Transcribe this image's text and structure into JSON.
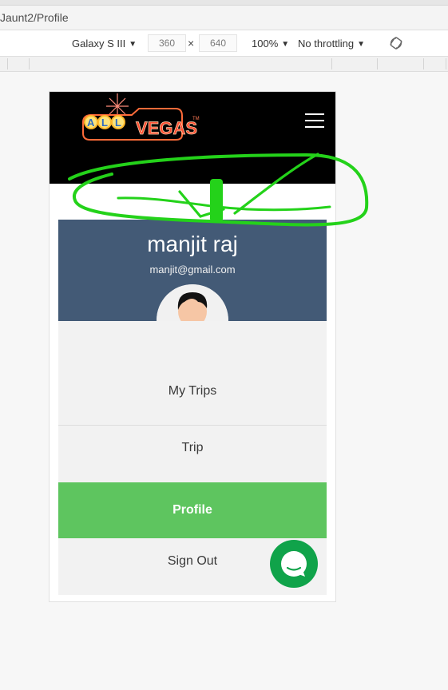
{
  "browser": {
    "address": "Jaunt2/Profile",
    "device": "Galaxy S III",
    "width": "360",
    "height": "640",
    "times": "×",
    "zoom": "100%",
    "throttling": "No throttling"
  },
  "app": {
    "brand": {
      "first": "ALL",
      "second": "VEGAS",
      "tm": "TM"
    },
    "profile": {
      "name": "manjit raj",
      "email": "manjit@gmail.com"
    },
    "menu": {
      "my_trips": "My Trips",
      "trip": "Trip",
      "profile": "Profile",
      "sign_out": "Sign Out"
    }
  },
  "colors": {
    "header_bg": "#000000",
    "banner_bg": "#435a76",
    "profile_active": "#5ec55f",
    "chat_bg": "#10a34a",
    "annotation": "#24d21a"
  }
}
